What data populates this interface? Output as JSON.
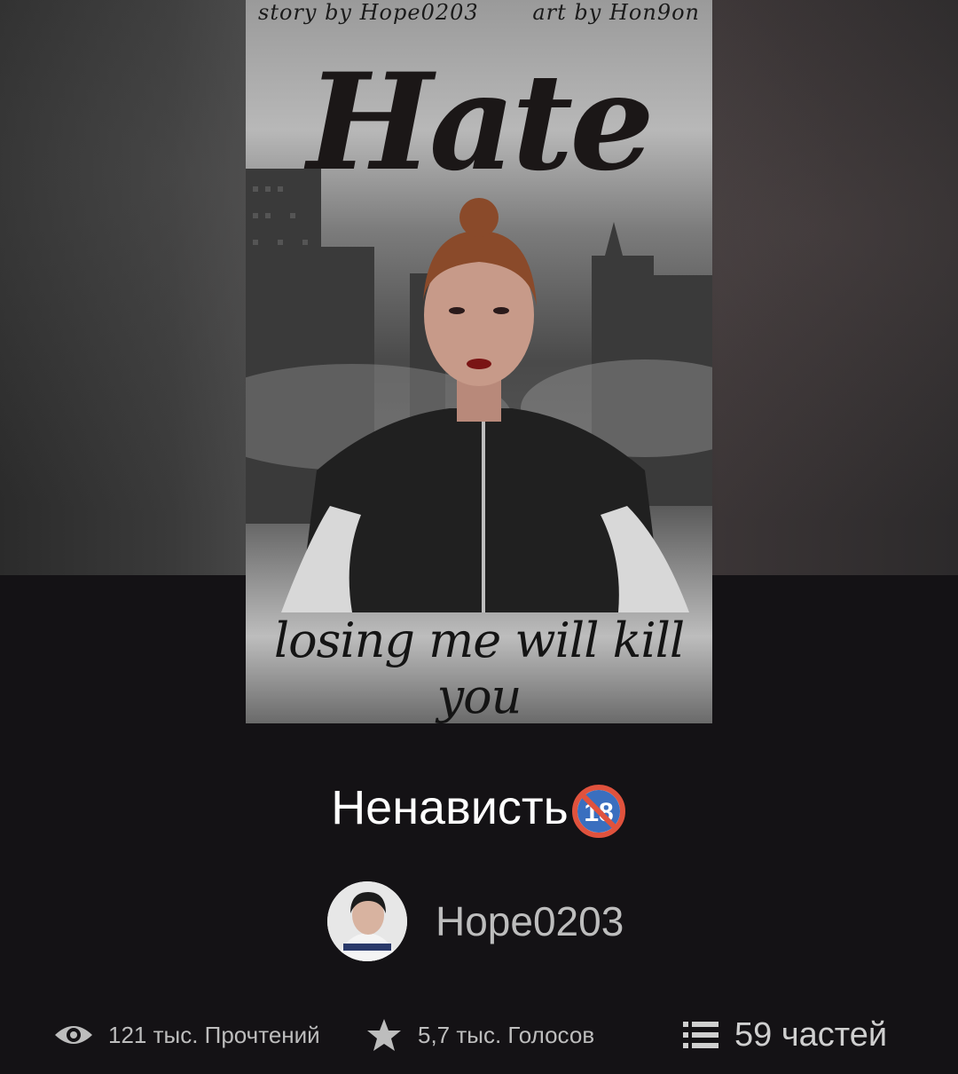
{
  "cover": {
    "credit_left": "story by Hope0203",
    "credit_right": "art by Hon9on",
    "title_art": "Hate",
    "tagline": "losing me will kill you",
    "colors": {
      "ink": "#1b1717",
      "lips": "#7a1414",
      "hair": "#8a4a2a"
    }
  },
  "book": {
    "title": "Ненависть",
    "badge_icon": "no-under-18-icon"
  },
  "author": {
    "name": "Hope0203",
    "avatar_icon": "user-avatar"
  },
  "stats": {
    "reads": {
      "icon": "eye-icon",
      "label": "121 тыс. Прочтений"
    },
    "votes": {
      "icon": "star-icon",
      "label": "5,7 тыс. Голосов"
    },
    "parts": {
      "icon": "list-icon",
      "label": "59 частей"
    }
  },
  "theme": {
    "background": "#141215",
    "title": "#ffffff",
    "muted": "#bdbdbd"
  }
}
